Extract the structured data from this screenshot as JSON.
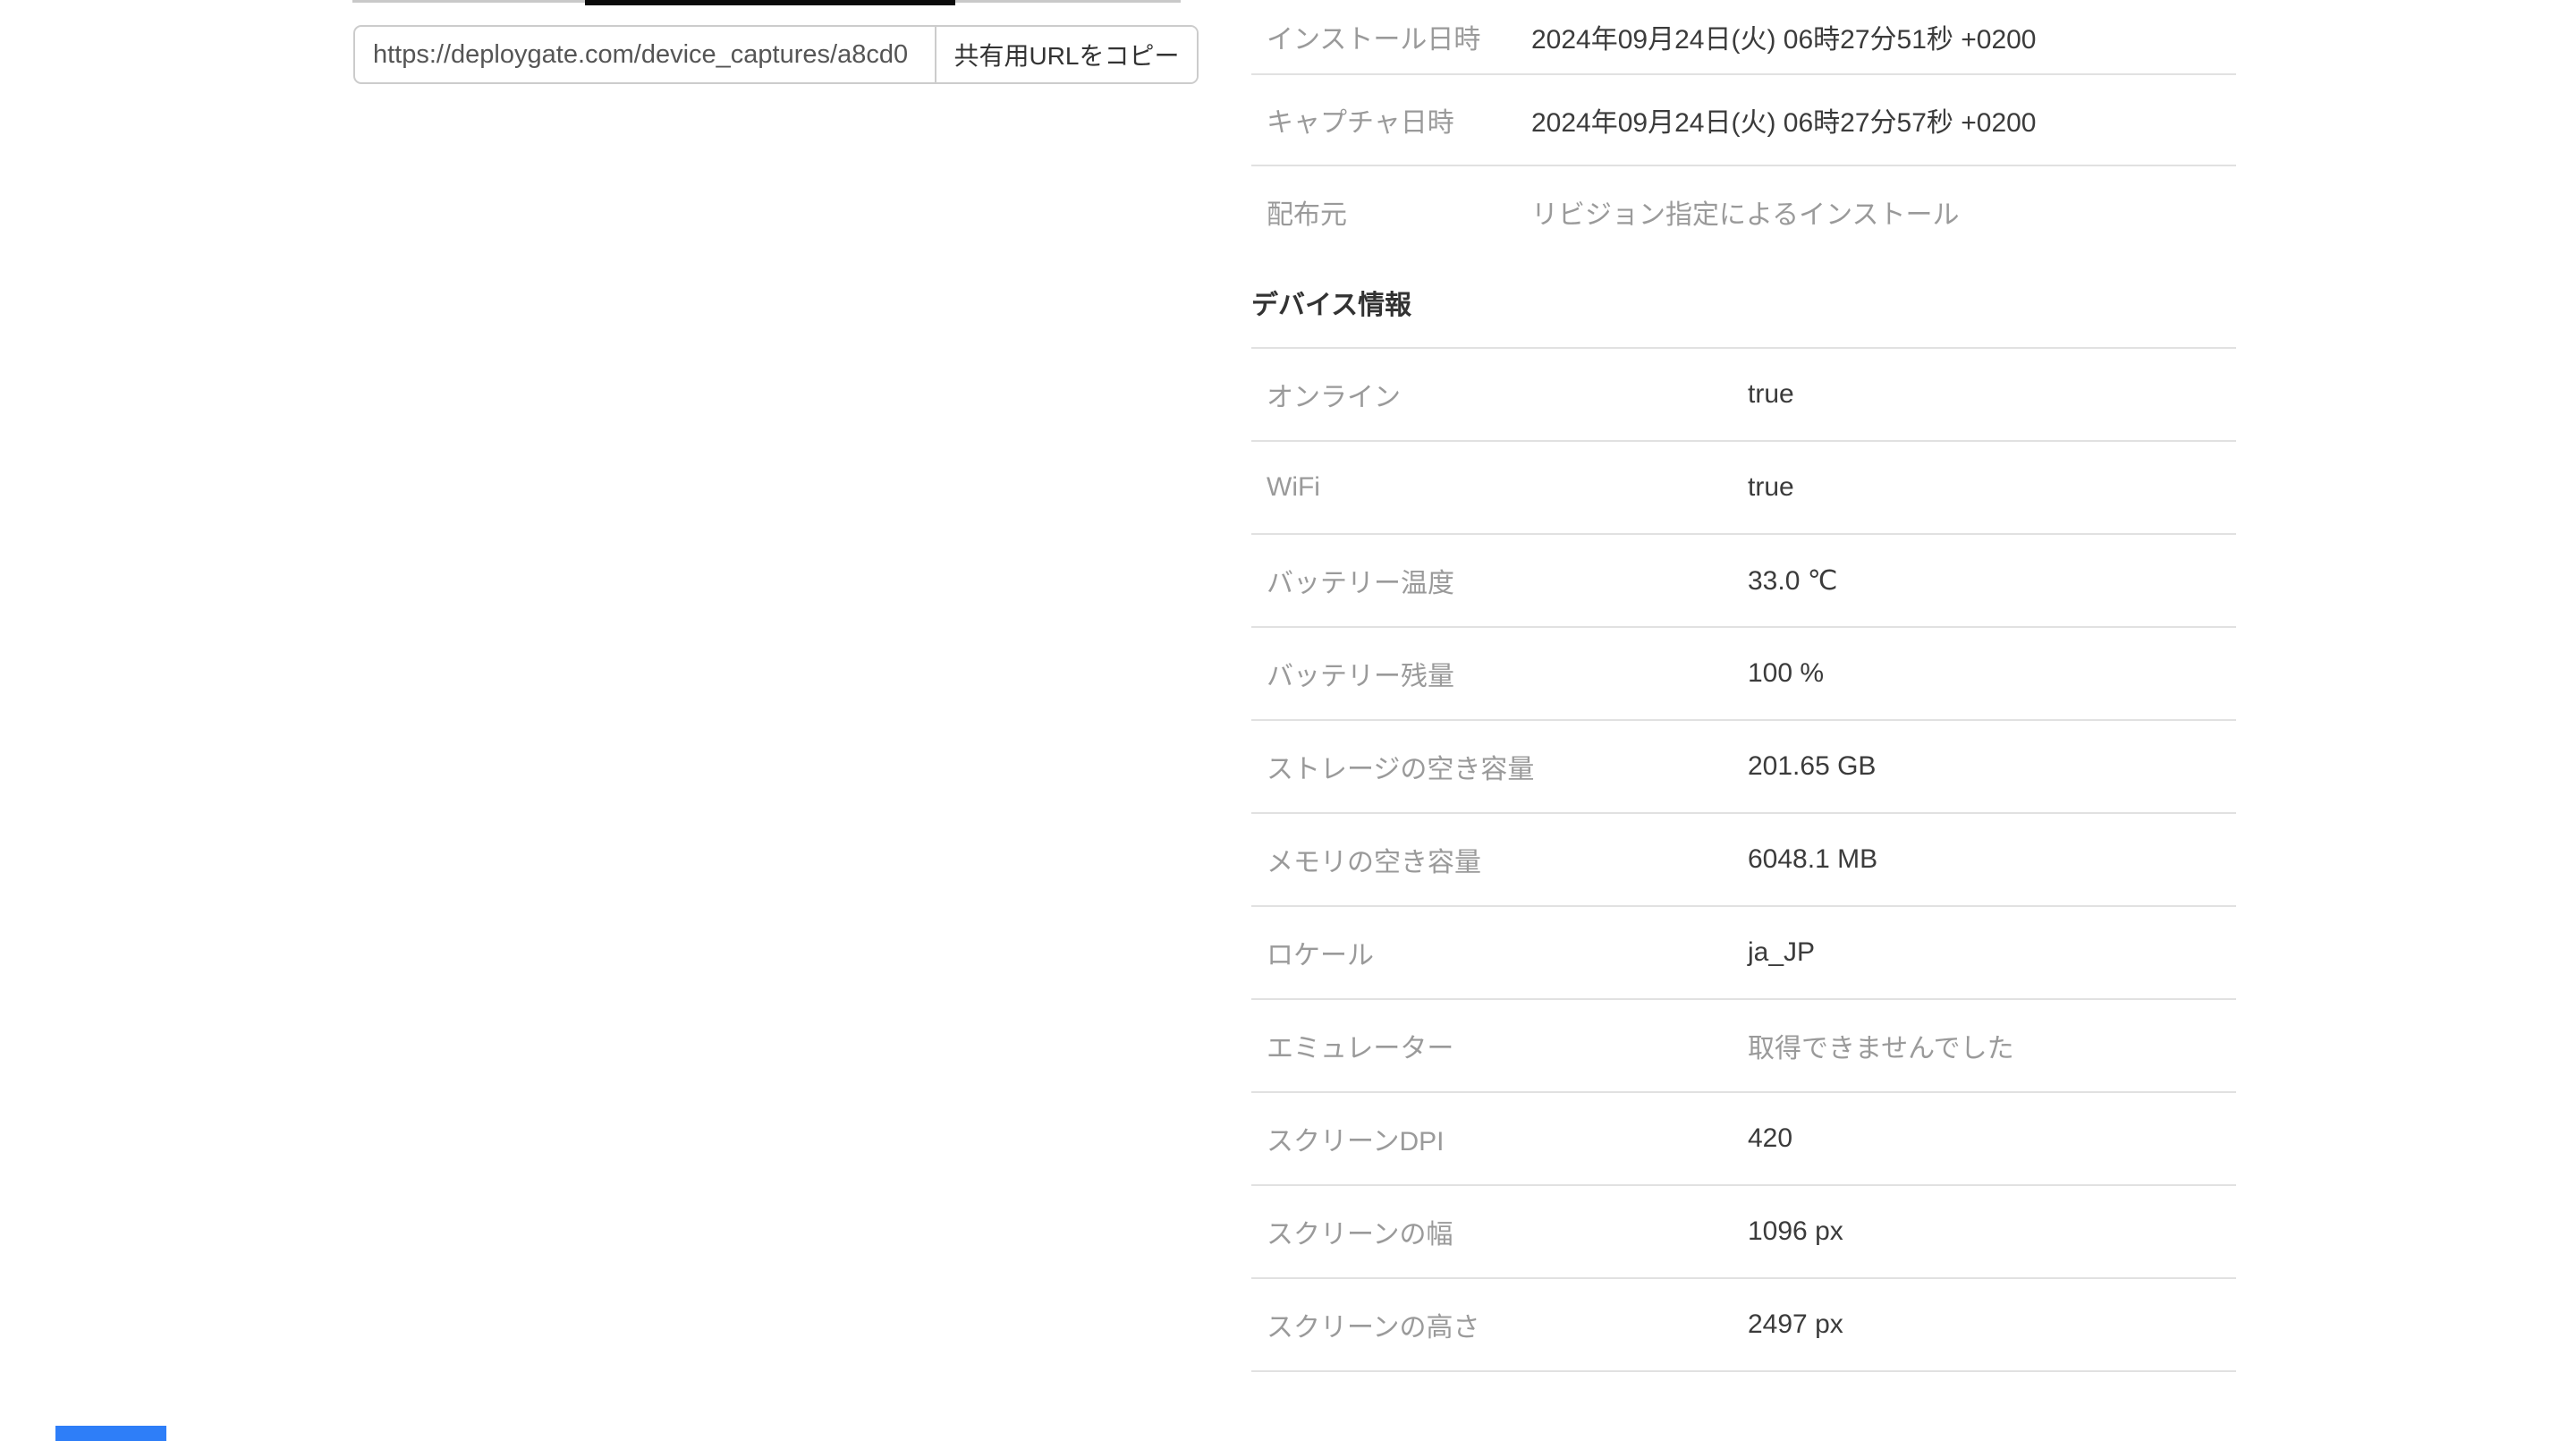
{
  "share": {
    "url_value": "https://deploygate.com/device_captures/a8cd0",
    "copy_button_label": "共有用URLをコピー"
  },
  "info": {
    "capture_rows": [
      {
        "label": "インストール日時",
        "value": "2024年09月24日(火) 06時27分51秒 +0200"
      },
      {
        "label": "キャプチャ日時",
        "value": "2024年09月24日(火) 06時27分57秒 +0200"
      },
      {
        "label": "配布元",
        "value": "リビジョン指定によるインストール"
      }
    ],
    "device_section_title": "デバイス情報",
    "device_rows": [
      {
        "label": "オンライン",
        "value": "true"
      },
      {
        "label": "WiFi",
        "value": "true"
      },
      {
        "label": "バッテリー温度",
        "value": "33.0 ℃"
      },
      {
        "label": "バッテリー残量",
        "value": "100 %"
      },
      {
        "label": "ストレージの空き容量",
        "value": "201.65 GB"
      },
      {
        "label": "メモリの空き容量",
        "value": "6048.1 MB"
      },
      {
        "label": "ロケール",
        "value": "ja_JP"
      },
      {
        "label": "エミュレーター",
        "value": "取得できませんでした"
      },
      {
        "label": "スクリーンDPI",
        "value": "420"
      },
      {
        "label": "スクリーンの幅",
        "value": "1096 px"
      },
      {
        "label": "スクリーンの高さ",
        "value": "2497 px"
      }
    ]
  },
  "colors": {
    "divider": "#e1e1e1",
    "label_gray": "#9a9a9a",
    "value_dark": "#3b3b3b",
    "accent_blue": "#2e7ef8",
    "screenshot_black_edge": "#0b0b0b"
  }
}
